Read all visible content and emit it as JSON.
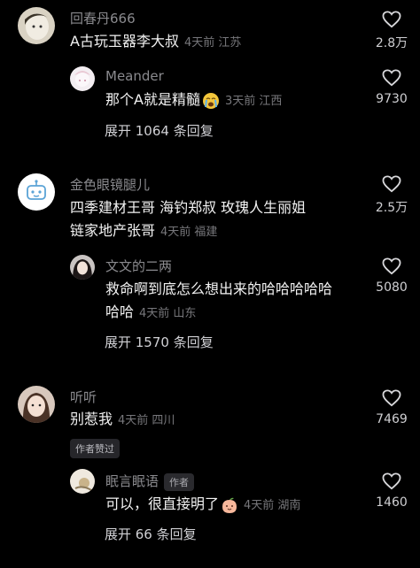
{
  "comments": [
    {
      "name": "回春丹666",
      "text": "A古玩玉器李大叔",
      "meta": "4天前 江苏",
      "likes": "2.8万",
      "reply": {
        "name": "Meander",
        "text": "那个A就是精髓",
        "emoji": "crying-face-emoji",
        "meta": "3天前 江西",
        "likes": "9730"
      },
      "expand": "展开 1064 条回复"
    },
    {
      "name": "金色眼镜腿儿",
      "text_line1": "四季建材王哥  海钓郑叔  玫瑰人生丽姐",
      "text_line2": "链家地产张哥",
      "meta": "4天前 福建",
      "likes": "2.5万",
      "reply": {
        "name": "文文的二两",
        "text_line1": "救命啊到底怎么想出来的哈哈哈哈哈",
        "text_line2": "哈哈",
        "meta": "4天前 山东",
        "likes": "5080"
      },
      "expand": "展开 1570 条回复"
    },
    {
      "name": "听听",
      "text": "别惹我",
      "meta": "4天前 四川",
      "likes": "7469",
      "badge": "作者赞过",
      "reply": {
        "name": "眠言眠语",
        "author_tag": "作者",
        "text": "可以，很直接明了",
        "emoji": "peach-face-emoji",
        "meta": "4天前 湖南",
        "likes": "1460"
      },
      "expand": "展开 66 条回复"
    }
  ]
}
